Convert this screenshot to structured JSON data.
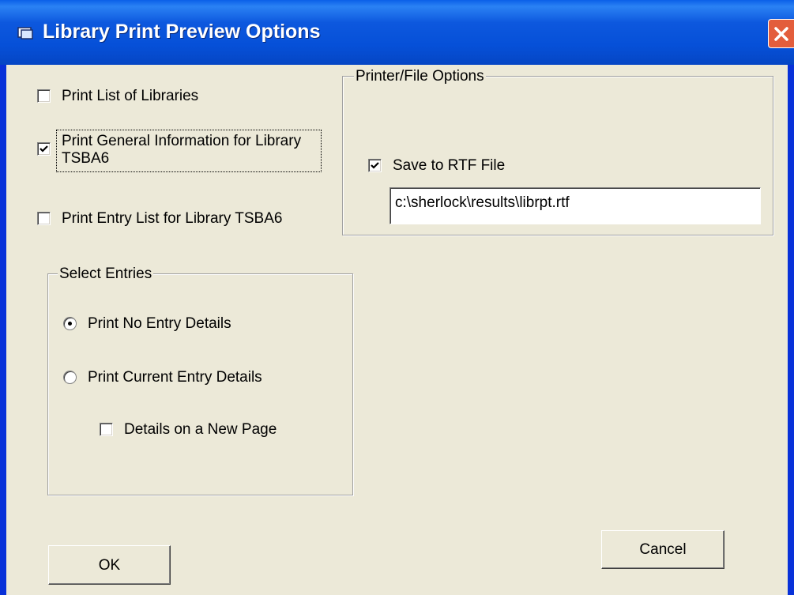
{
  "window": {
    "title": "Library Print Preview Options"
  },
  "options": {
    "list_libraries": {
      "label": "Print  List of Libraries",
      "checked": false
    },
    "general_info": {
      "label_line1": "Print General Information for Library",
      "label_line2": "TSBA6",
      "checked": true
    },
    "entry_list": {
      "label": "Print Entry List for Library TSBA6",
      "checked": false
    }
  },
  "select_entries": {
    "title": "Select Entries",
    "no_details": {
      "label": "Print No Entry Details",
      "selected": true
    },
    "current_details": {
      "label": "Print Current Entry Details",
      "selected": false
    },
    "new_page": {
      "label": "Details on a New Page",
      "checked": false
    }
  },
  "printer_file": {
    "title": "Printer/File Options",
    "save_rtf": {
      "label": "Save to RTF File",
      "checked": true
    },
    "file_path": "c:\\sherlock\\results\\librpt.rtf"
  },
  "buttons": {
    "ok": "OK",
    "cancel": "Cancel"
  },
  "icons": {
    "title": "window-icon",
    "close": "close-icon",
    "check": "checkmark-icon"
  },
  "colors": {
    "titlebar": "#0550d8",
    "close": "#e35d3c",
    "face": "#ece9d8"
  }
}
